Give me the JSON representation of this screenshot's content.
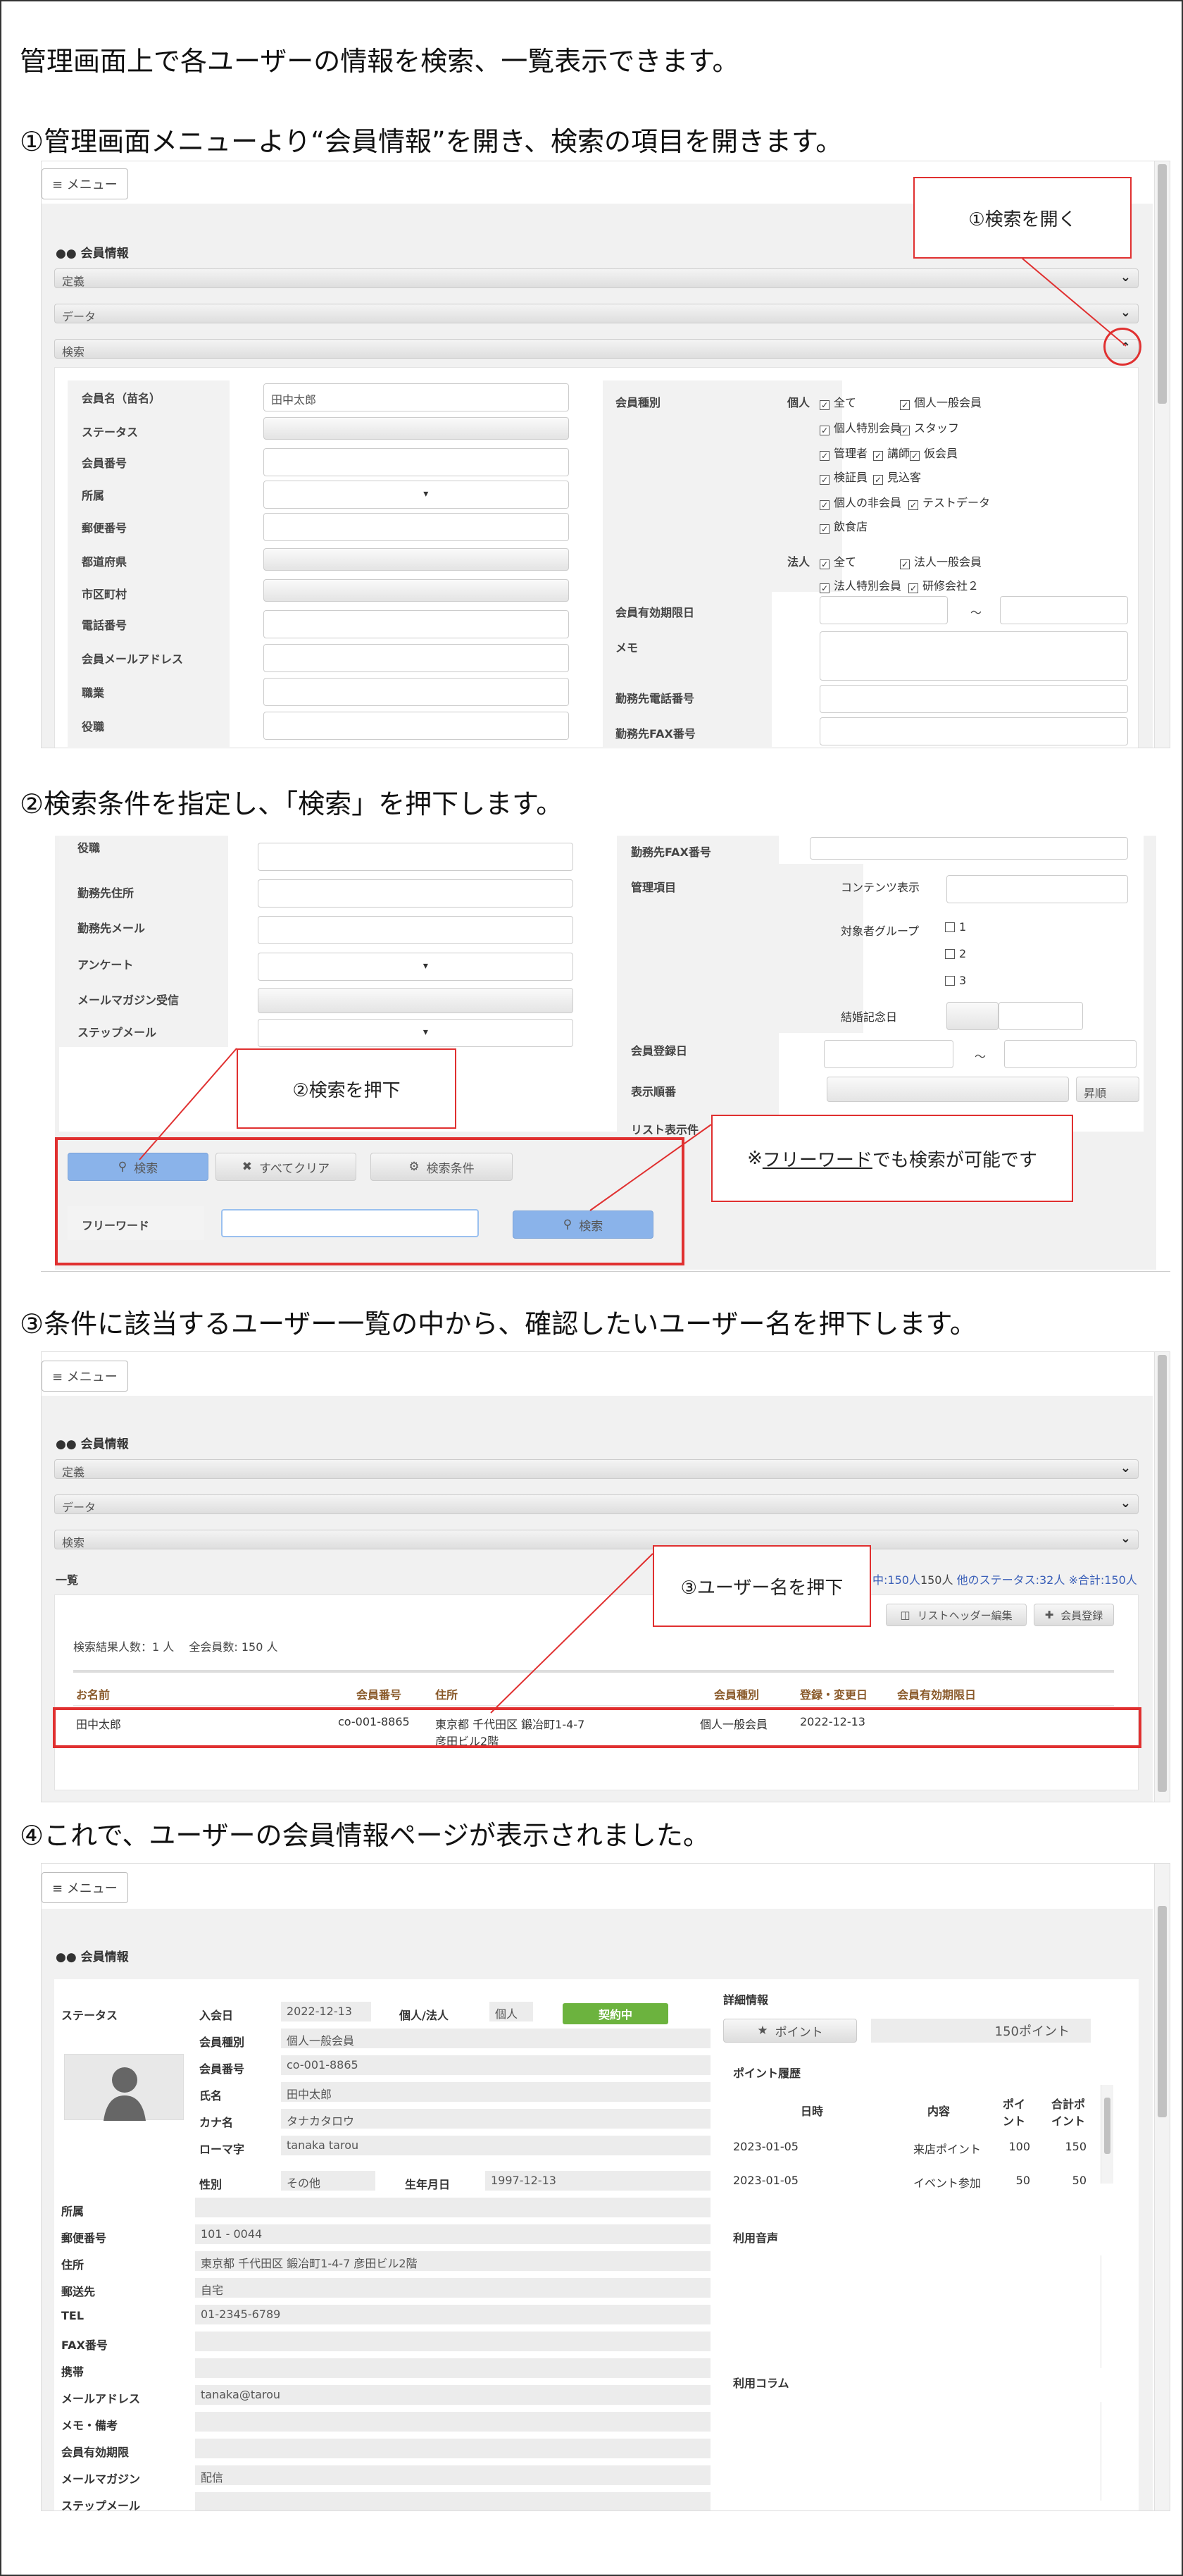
{
  "intro": "管理画面上で各ユーザーの情報を検索、一覧表示できます。",
  "steps": [
    {
      "title": "①管理画面メニューより“会員情報”を開き、検索の項目を開きます。"
    },
    {
      "title": "②検索条件を指定し、「検索」を押下します。"
    },
    {
      "title": "③条件に該当するユーザー一覧の中から、確認したいユーザー名を押下します。"
    },
    {
      "title": "④これで、ユーザーの会員情報ページが表示されました。"
    }
  ],
  "common": {
    "menu_icon": "hamburger-icon",
    "menu_label": "≡ メニュー",
    "section_icon": "users-icon",
    "section_title": "会員情報",
    "bar_teigi": "定義",
    "bar_data": "データ",
    "bar_search": "検索",
    "chev_down": "⌄",
    "chev_up": "⌃"
  },
  "shot1": {
    "callout": "①検索を開く",
    "left_labels": [
      "会員名（苗名）",
      "ステータス",
      "会員番号",
      "所属",
      "郵便番号",
      "都道府県",
      "市区町村",
      "電話番号",
      "会員メールアドレス",
      "職業",
      "役職"
    ],
    "name_value": "田中太郎",
    "kind_label": "会員種別",
    "personal": "個人",
    "corporate": "法人",
    "personal_checks": [
      "全て",
      "個人一般会員",
      "個人特別会員",
      "スタッフ",
      "管理者",
      "講師",
      "仮会員",
      "検証員",
      "見込客",
      "個人の非会員",
      "テストデータ",
      "飲食店"
    ],
    "corp_checks": [
      "全て",
      "法人一般会員",
      "法人特別会員",
      "研修会社２"
    ],
    "expire_label": "会員有効期限日",
    "tilde": "～",
    "memo_label": "メモ",
    "work_tel": "勤務先電話番号",
    "work_fax": "勤務先FAX番号"
  },
  "shot2": {
    "left_labels": [
      "役職",
      "勤務先住所",
      "勤務先メール",
      "アンケート",
      "メールマガジン受信",
      "ステップメール"
    ],
    "r_fax": "勤務先FAX番号",
    "r_manage": "管理項目",
    "contents": "コンテンツ表示",
    "target_group": "対象者グループ",
    "opts": [
      "1",
      "2",
      "3"
    ],
    "anniv": "結婚記念日",
    "reg_date": "会員登録日",
    "tilde": "～",
    "order": "表示順番",
    "asc": "昇順",
    "list_disp": "リスト表示件",
    "callout_search": "②検索を押下",
    "callout_free_pre": "※",
    "callout_free_link": "フリーワード",
    "callout_free_post": "でも検索が可能です",
    "btn_search": "検索",
    "btn_clear": "すべてクリア",
    "btn_cond": "検索条件",
    "free_label": "フリーワード"
  },
  "shot3": {
    "list_label": "一覧",
    "callout": "③ユーザー名を押下",
    "stats_a": "中:150人",
    "stats_b": "他のステータス:32人",
    "stats_c": "※合計:150人",
    "btn_header": "リストヘッダー編集",
    "btn_add": "会員登録",
    "result": "検索結果人数：1 人　 全会員数: 150 人",
    "cols": [
      "お名前",
      "会員番号",
      "住所",
      "会員種別",
      "登録・変更日",
      "会員有効期限日"
    ],
    "row": {
      "name": "田中太郎",
      "no": "co-001-8865",
      "addr1": "東京都 千代田区 鍛冶町1-4-7",
      "addr2": "彦田ビル2階",
      "kind": "個人一般会員",
      "date": "2022-12-13"
    }
  },
  "shot4": {
    "status": "ステータス",
    "join_label": "入会日",
    "join": "2022-12-13",
    "pc_label": "個人/法人",
    "pc": "個人",
    "contract": "契約中",
    "rows": [
      [
        "会員種別",
        "個人一般会員"
      ],
      [
        "会員番号",
        "co-001-8865"
      ],
      [
        "氏名",
        "田中太郎"
      ],
      [
        "カナ名",
        "タナカタロウ"
      ],
      [
        "ローマ字",
        "tanaka tarou"
      ]
    ],
    "sex_label": "性別",
    "sex": "その他",
    "birth_label": "生年月日",
    "birth": "1997-12-13",
    "lower": [
      [
        "所属",
        ""
      ],
      [
        "郵便番号",
        "101 - 0044"
      ],
      [
        "住所",
        "東京都 千代田区 鍛冶町1-4-7 彦田ビル2階"
      ],
      [
        "郵送先",
        "自宅"
      ],
      [
        "TEL",
        "01-2345-6789"
      ],
      [
        "FAX番号",
        ""
      ],
      [
        "携帯",
        ""
      ],
      [
        "メールアドレス",
        "tanaka@tarou"
      ],
      [
        "メモ・備考",
        ""
      ],
      [
        "会員有効期限",
        ""
      ],
      [
        "メールマガジン",
        "配信"
      ],
      [
        "ステップメール",
        ""
      ]
    ],
    "detail": "詳細情報",
    "point_btn": "ポイント",
    "point_total": "150ポイント",
    "history": "ポイント履歴",
    "hcols": [
      "日時",
      "内容",
      "ポイント",
      "合計ポイント"
    ],
    "hrows": [
      [
        "2023-01-05",
        "来店ポイント",
        "100",
        "150"
      ],
      [
        "2023-01-05",
        "イベント参加",
        "50",
        "50"
      ]
    ],
    "voice": "利用音声",
    "column": "利用コラム"
  }
}
